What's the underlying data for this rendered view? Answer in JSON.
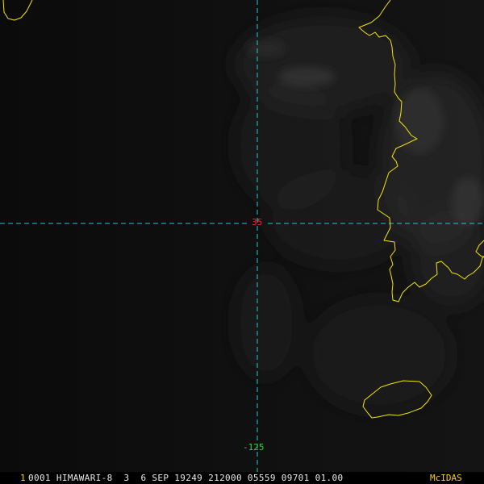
{
  "map": {
    "latitude_label": "35",
    "longitude_label": "-125",
    "graticule_color": "#27c4d4",
    "coastline_color": "#f5e600",
    "latitude_label_color": "#ff2020",
    "longitude_label_color": "#2bd52b"
  },
  "status": {
    "frame_number": "1",
    "header": "0001 HIMAWARI-8  3  6 SEP 19249 212000 05559 09701 01.00",
    "brand": "McIDAS"
  }
}
